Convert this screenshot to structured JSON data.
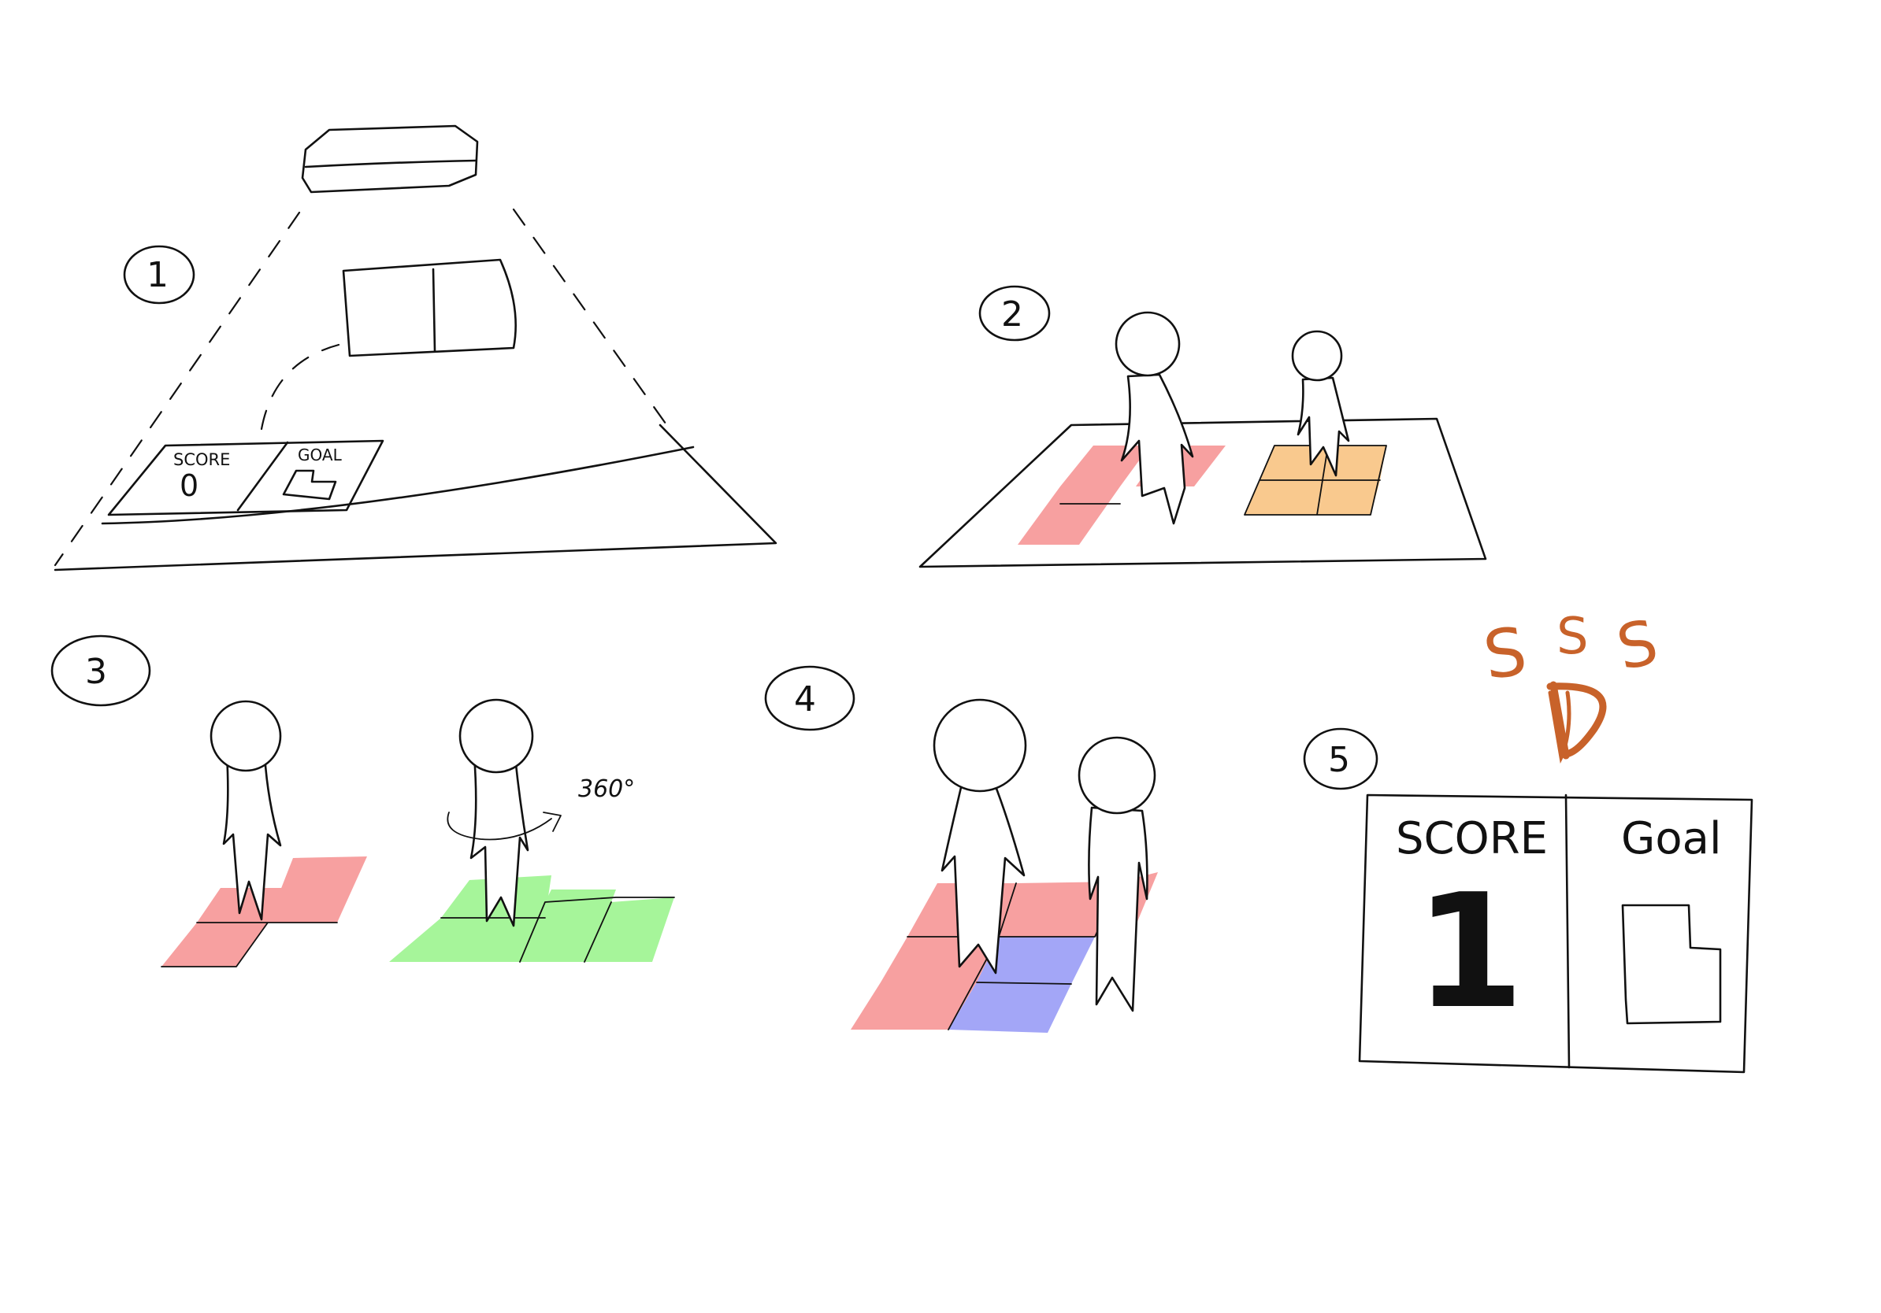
{
  "panel1": {
    "step_number": "1",
    "score_label": "SCORE",
    "score_value": "0",
    "goal_label": "GOAL"
  },
  "panel2": {
    "step_number": "2"
  },
  "panel3": {
    "step_number": "3",
    "rotation_label": "360°"
  },
  "panel4": {
    "step_number": "4"
  },
  "panel5": {
    "step_number": "5",
    "score_label": "SCORE",
    "score_value": "1",
    "goal_label": "Goal",
    "celebration_color": "#c8622a"
  },
  "colors": {
    "tile_red": "#f7a0a0",
    "tile_orange": "#f9c98e",
    "tile_green": "#a6f59a",
    "tile_blue": "#a3a6f7"
  }
}
